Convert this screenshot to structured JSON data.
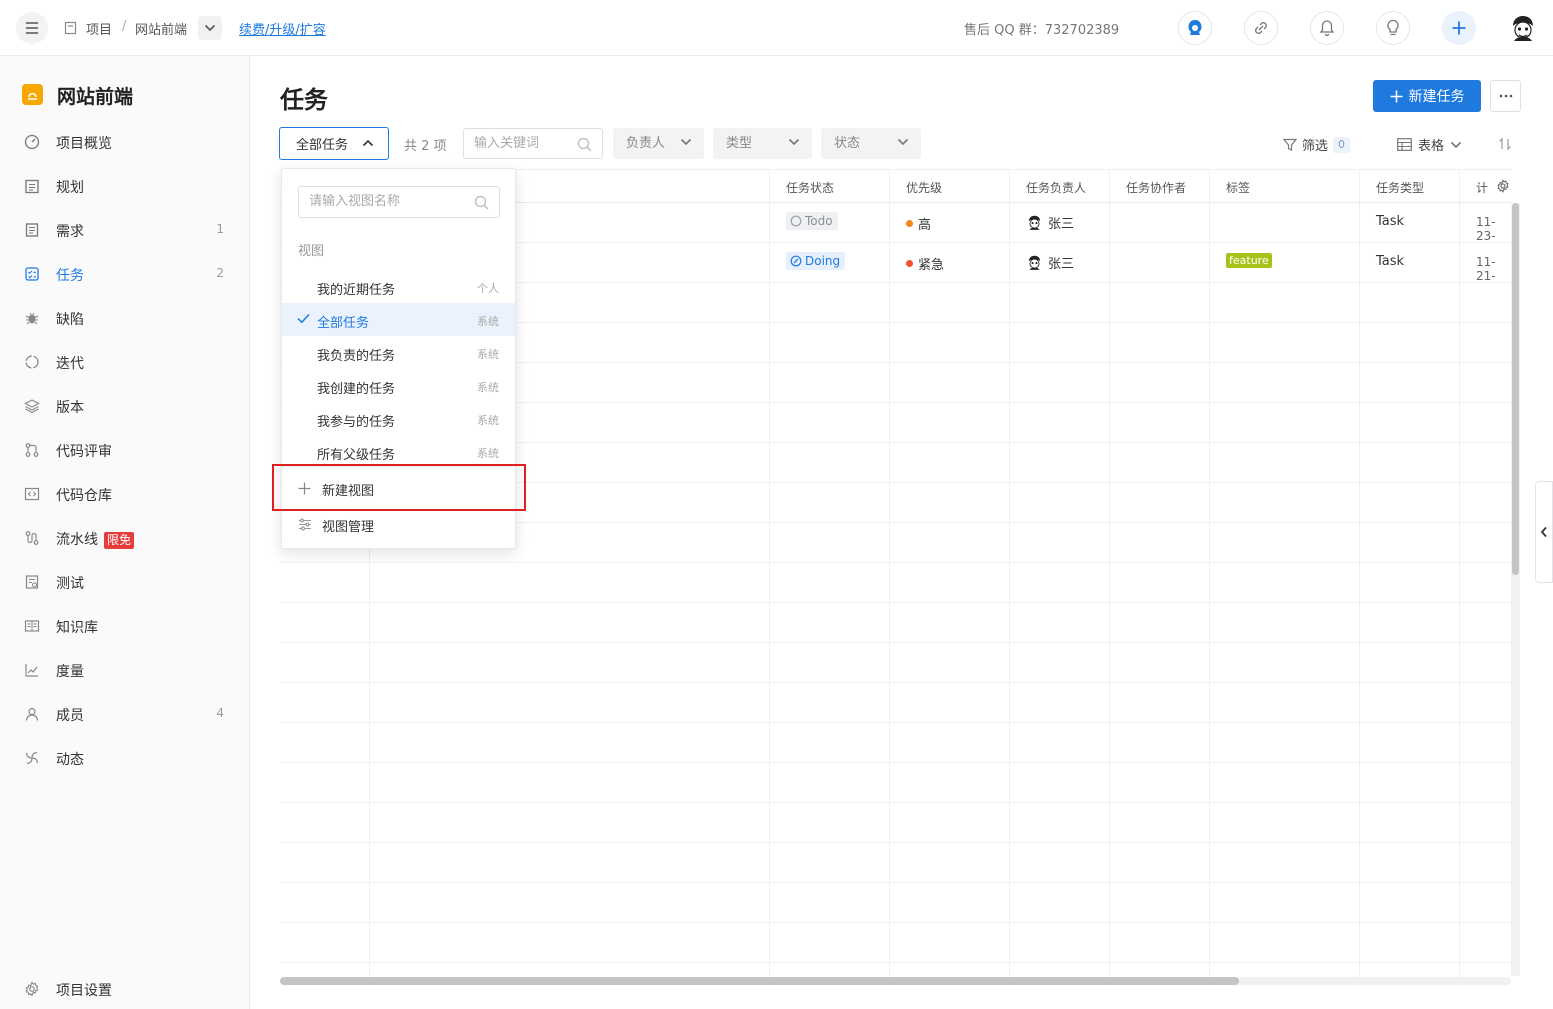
{
  "topbar": {
    "breadcrumb": [
      "项目",
      "/",
      "网站前端"
    ],
    "renew_link": "续费/升级/扩容",
    "support_qq": "售后 QQ 群：732702389"
  },
  "sidebar": {
    "project_name": "网站前端",
    "items": [
      {
        "label": "项目概览",
        "count": "",
        "icon": "dashboard-icon"
      },
      {
        "label": "规划",
        "count": "",
        "icon": "calendar-icon"
      },
      {
        "label": "需求",
        "count": "1",
        "icon": "document-icon"
      },
      {
        "label": "任务",
        "count": "2",
        "icon": "task-icon"
      },
      {
        "label": "缺陷",
        "count": "",
        "icon": "bug-icon"
      },
      {
        "label": "迭代",
        "count": "",
        "icon": "cycle-icon"
      },
      {
        "label": "版本",
        "count": "",
        "icon": "layers-icon"
      },
      {
        "label": "代码评审",
        "count": "",
        "icon": "merge-icon"
      },
      {
        "label": "代码仓库",
        "count": "",
        "icon": "code-icon"
      },
      {
        "label": "流水线",
        "count": "",
        "icon": "pipeline-icon",
        "badge": "限免"
      },
      {
        "label": "测试",
        "count": "",
        "icon": "test-icon"
      },
      {
        "label": "知识库",
        "count": "",
        "icon": "book-icon"
      },
      {
        "label": "度量",
        "count": "",
        "icon": "chart-icon"
      },
      {
        "label": "成员",
        "count": "4",
        "icon": "user-icon"
      },
      {
        "label": "动态",
        "count": "",
        "icon": "activity-icon"
      }
    ],
    "settings_label": "项目设置"
  },
  "main": {
    "title": "任务",
    "new_task_label": "新建任务",
    "view_select": "全部任务",
    "total": "共 2 项",
    "keyword_placeholder": "输入关键词",
    "filters": [
      "负责人",
      "类型",
      "状态"
    ],
    "filter_label": "筛选",
    "filter_count": "0",
    "table_mode": "表格"
  },
  "table": {
    "headers": [
      "任务状态",
      "优先级",
      "任务负责人",
      "任务协作者",
      "标签",
      "任务类型",
      "计"
    ],
    "rows": [
      {
        "status": "Todo",
        "priority": "高",
        "priority_color": "#f5841f",
        "assignee": "张三",
        "tag": "",
        "type": "Task",
        "date": "11-23-"
      },
      {
        "status": "Doing",
        "priority": "紧急",
        "priority_color": "#f0542d",
        "assignee": "张三",
        "tag": "feature",
        "type": "Task",
        "date": "11-21-"
      }
    ]
  },
  "dropdown": {
    "search_placeholder": "请输入视图名称",
    "group_label": "视图",
    "views": [
      {
        "label": "我的近期任务",
        "tag": "个人",
        "selected": false
      },
      {
        "label": "全部任务",
        "tag": "系统",
        "selected": true
      },
      {
        "label": "我负责的任务",
        "tag": "系统",
        "selected": false
      },
      {
        "label": "我创建的任务",
        "tag": "系统",
        "selected": false
      },
      {
        "label": "我参与的任务",
        "tag": "系统",
        "selected": false
      },
      {
        "label": "所有父级任务",
        "tag": "系统",
        "selected": false
      }
    ],
    "new_view_label": "新建视图",
    "manage_label": "视图管理"
  },
  "colors": {
    "accent": "#1f7ae0",
    "highlight": "#e02020",
    "logo": "#f8a600"
  }
}
